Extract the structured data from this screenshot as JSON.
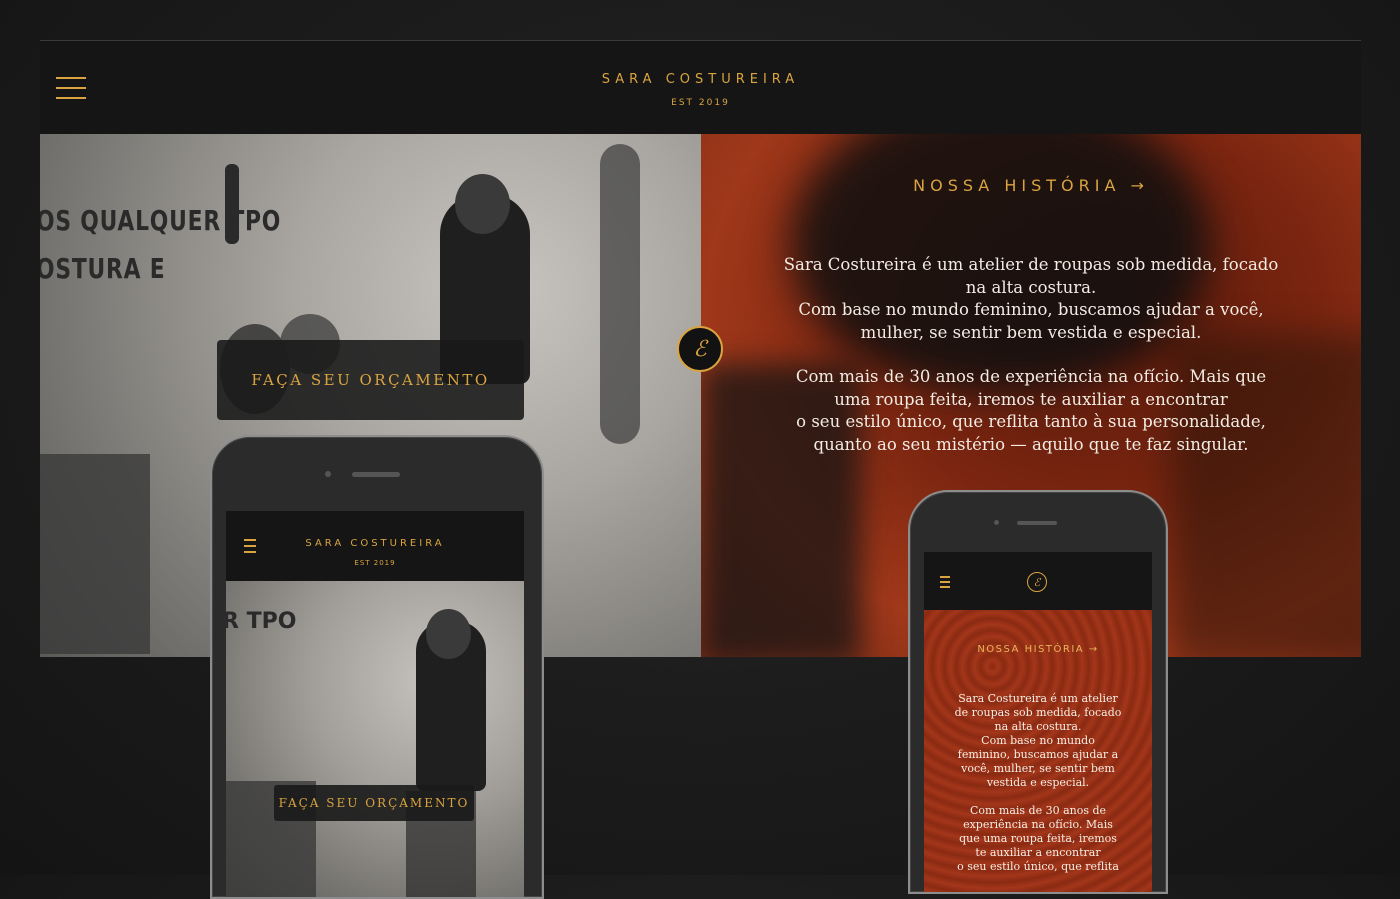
{
  "header": {
    "brand": "SARA COSTUREIRA",
    "est": "EST 2019",
    "menu_icon": "hamburger-icon"
  },
  "hero": {
    "wall_text_line1": "OS QUALQUER TPO",
    "wall_text_line2": "OSTURA E",
    "cta_label": "FAÇA SEU ORÇAMENTO"
  },
  "history": {
    "title": "NOSSA HISTÓRIA →",
    "para1_line1": "Sara Costureira é um atelier de roupas sob medida, focado",
    "para1_line2": "na alta costura.",
    "para1_line3": "Com base no mundo feminino, buscamos ajudar a você,",
    "para1_line4": "mulher, se sentir bem vestida e especial.",
    "para2_line1": "Com mais de 30 anos de experiência na ofício. Mais que",
    "para2_line2": "uma roupa feita, iremos te auxiliar a encontrar",
    "para2_line3": "o seu estilo único, que reflita tanto à sua personalidade,",
    "para2_line4": "quanto ao seu mistério — aquilo que te faz singular."
  },
  "badge": {
    "icon": "monogram-logo-icon",
    "glyph": "ℰ"
  },
  "phone_left": {
    "brand": "SARA COSTUREIRA",
    "est": "EST 2019",
    "wall_text": "R TPO",
    "cta_label": "FAÇA SEU ORÇAMENTO"
  },
  "phone_right": {
    "logo_glyph": "ℰ",
    "title": "NOSSA HISTÓRIA →",
    "p1_l1": "Sara Costureira é um atelier",
    "p1_l2": "de roupas sob medida, focado",
    "p1_l3": "na alta costura.",
    "p1_l4": "Com base no mundo",
    "p1_l5": "feminino, buscamos ajudar a",
    "p1_l6": "você, mulher, se sentir bem",
    "p1_l7": "vestida e especial.",
    "p2_l1": "Com mais de 30 anos de",
    "p2_l2": "experiência na ofício. Mais",
    "p2_l3": "que uma roupa feita, iremos",
    "p2_l4": "te auxiliar a encontrar",
    "p2_l5": "o seu estilo único, que reflita"
  },
  "colors": {
    "accent": "#d9a440",
    "dark": "#151515",
    "red": "#a0381a"
  }
}
